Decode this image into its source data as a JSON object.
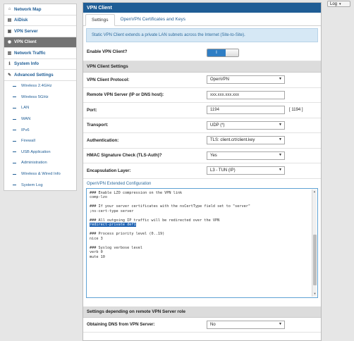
{
  "topbar": {
    "log_label": "Log",
    "log_caret": "▾"
  },
  "sidebar": {
    "items": [
      {
        "label": "Network Map",
        "icon": "home-icon",
        "glyph": "⌂"
      },
      {
        "label": "AiDisk",
        "icon": "disk-icon",
        "glyph": "▤"
      },
      {
        "label": "VPN Server",
        "icon": "server-icon",
        "glyph": "▣"
      },
      {
        "label": "VPN Client",
        "icon": "globe-icon",
        "glyph": "◉"
      },
      {
        "label": "Network Traffic",
        "icon": "chart-icon",
        "glyph": "▥"
      },
      {
        "label": "System Info",
        "icon": "info-icon",
        "glyph": "ℹ"
      },
      {
        "label": "Advanced Settings",
        "icon": "wrench-icon",
        "glyph": "✎"
      }
    ],
    "sub_items": [
      "Wireless 2.4GHz",
      "Wireless 5GHz",
      "LAN",
      "WAN",
      "IPv6",
      "Firewall",
      "USB Application",
      "Administration",
      "Wireless & Wired Info",
      "System Log"
    ]
  },
  "main": {
    "title": "VPN Client",
    "tabs": [
      "Settings",
      "OpenVPN Certificates and Keys"
    ],
    "info": "Static VPN Client extends a private LAN subnets across the Internet (Site-to-Site).",
    "enable_label": "Enable VPN Client?",
    "enable_toggle": "I",
    "section_title": "VPN Client Settings",
    "fields": {
      "protocol": {
        "label": "VPN Client Protocol:",
        "value": "OpenVPN"
      },
      "remote": {
        "label": "Remote VPN Server (IP or DNS host):",
        "value": "xxx.xxx.xxx.xxx"
      },
      "port": {
        "label": "Port:",
        "value": "1194",
        "hint": "[ 1194 ]"
      },
      "transport": {
        "label": "Transport:",
        "value": "UDP (*)"
      },
      "auth": {
        "label": "Authentication:",
        "value": "TLS: client.crt/client.key"
      },
      "hmac": {
        "label": "HMAC Signature Check (TLS-Auth)?",
        "value": "Yes"
      },
      "encap": {
        "label": "Encapsulation Layer:",
        "value": "L3 - TUN (IP)"
      }
    },
    "config_label": "OpenVPN Extended Configuration",
    "config_lines": [
      "### Enable LZO compression on the VPN link",
      "comp-lzo",
      "",
      "### If your server certificates with the nsCertType field set to \"server\"",
      ";ns-cert-type server",
      "",
      "### All outgoing IP traffic will be redirected over the VPN",
      "redirect-private def1",
      "",
      "### Process priority level (0..19)",
      "nice 3",
      "",
      "### Syslog verbose level",
      "verb 0",
      "mute 10"
    ],
    "config_highlight_index": 7,
    "remote_section_title": "Settings depending on remote VPN Server role",
    "dns": {
      "label": "Obtaining DNS from VPN Server:",
      "value": "No"
    }
  },
  "colors": {
    "accent": "#1f5d95",
    "active_nav": "#737373",
    "toggle_on": "#2f7ec4"
  }
}
